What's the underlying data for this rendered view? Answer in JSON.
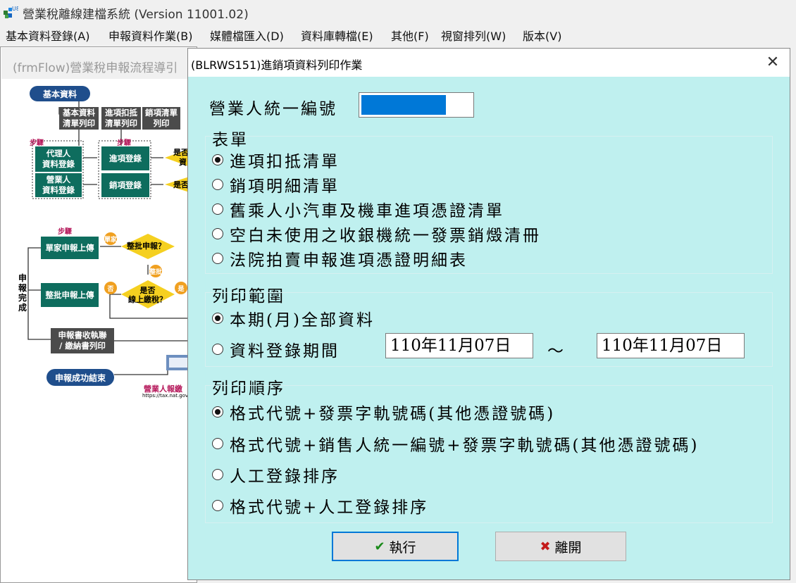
{
  "app": {
    "title": "營業稅離線建檔系統 (Version 11001.02)",
    "icon_text": "U8"
  },
  "menu": [
    {
      "label": "基本資料登錄(A)"
    },
    {
      "label": "申報資料作業(B)"
    },
    {
      "label": "媒體檔匯入(D)"
    },
    {
      "label": "資料庫轉檔(E)"
    },
    {
      "label": "其他(F)"
    },
    {
      "label": "視窗排列(W)"
    },
    {
      "label": "版本(V)"
    }
  ],
  "flow_window": {
    "title": "(frmFlow)營業稅申報流程導引",
    "nodes": {
      "basic": "基本資料",
      "basic_print": "基本資料\n清單列印",
      "input_print": "進項扣抵\n清單列印",
      "sales_print": "銷項清單\n列印",
      "step1": "步驟",
      "step2": "步驟",
      "agent_reg": "代理人\n資料登錄",
      "business_reg": "營業人\n資料登錄",
      "input_reg": "進項登錄",
      "sales_reg": "銷項登錄",
      "cond_a": "是否",
      "cond_a2": "資",
      "cond_b": "是否",
      "step13": "步驟",
      "single_upload": "單家申報上傳",
      "single_badge": "單家",
      "batch_q": "整批申報？",
      "batch_badge": "整批",
      "batch_upload": "整批申報上傳",
      "no_badge": "否",
      "yes_badge": "是",
      "online_q": "是否\n線上繳稅？",
      "done_side": "申\n報\n完\n成",
      "receipt_print": "申報書收執聯\n/ 繳納書列印",
      "success_end": "申報成功結束",
      "portal": "營業人報繳",
      "url": "https://tax.nat.gov.tw/al"
    }
  },
  "dialog": {
    "title": "(BLRWS151)進銷項資料列印作業",
    "close_icon": "close-icon",
    "ban_label": "營業人統一編號",
    "form_group": {
      "label": "表單",
      "options": [
        {
          "label": "進項扣抵清單",
          "selected": true
        },
        {
          "label": "銷項明細清單",
          "selected": false
        },
        {
          "label": "舊乘人小汽車及機車進項憑證清單",
          "selected": false
        },
        {
          "label": "空白未使用之收銀機統一發票銷燬清冊",
          "selected": false
        },
        {
          "label": "法院拍賣申報進項憑證明細表",
          "selected": false
        }
      ]
    },
    "range_group": {
      "label": "列印範圍",
      "options": [
        {
          "label": "本期(月)全部資料",
          "selected": true
        },
        {
          "label": "資料登錄期間",
          "selected": false
        }
      ],
      "date_from": "110年11月07日",
      "tilde": "～",
      "date_to": "110年11月07日"
    },
    "order_group": {
      "label": "列印順序",
      "options": [
        {
          "label": "格式代號+發票字軌號碼(其他憑證號碼)",
          "selected": true
        },
        {
          "label": "格式代號+銷售人統一編號+發票字軌號碼(其他憑證號碼)",
          "selected": false
        },
        {
          "label": "人工登錄排序",
          "selected": false
        },
        {
          "label": "格式代號+人工登錄排序",
          "selected": false
        }
      ]
    },
    "buttons": {
      "execute": "執行",
      "execute_icon": "check-icon",
      "leave": "離開",
      "leave_icon": "x-icon"
    }
  },
  "colors": {
    "dialog_bg": "#bff0ef",
    "flow_green": "#0e6d5e",
    "flow_blue": "#1f4e8c",
    "decision_yellow": "#f5d020",
    "selection_blue": "#0078d7",
    "check_green": "#1a8a1a",
    "x_red": "#c41a1a"
  }
}
